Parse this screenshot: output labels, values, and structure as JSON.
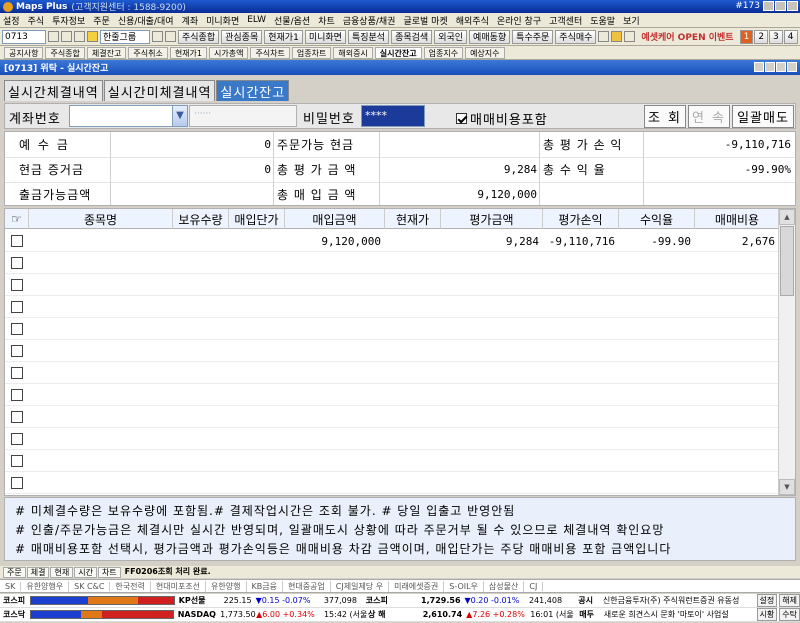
{
  "app": {
    "title": "Maps Plus",
    "subtitle": "(고객지원센터 : 1588-9200)",
    "window_num": "#173"
  },
  "menu": [
    "설정",
    "주식",
    "투자정보",
    "주문",
    "신용/대출/대여",
    "계좌",
    "미니화면",
    "ELW",
    "선물/옵션",
    "차트",
    "금융상품/채권",
    "글로벌 마켓",
    "해외주식",
    "온라인 창구",
    "고객센터",
    "도움말",
    "보기"
  ],
  "toolbar": {
    "screen_no": "0713",
    "group": "한줄그룹",
    "buttons": [
      "주식종합",
      "관심종목",
      "현재가1",
      "미니화면",
      "특징분석",
      "종목검색",
      "외국인",
      "예매동향",
      "특수주문",
      "주식매수"
    ],
    "event": "예셋케어 OPEN 이벤트",
    "pages": [
      "1",
      "2",
      "3",
      "4"
    ]
  },
  "window_tabs": [
    "공지사항",
    "주식종합",
    "체결잔고",
    "주식취소",
    "현재가1",
    "시가총액",
    "주식차트",
    "업종차트",
    "해외증시",
    "실시간잔고",
    "업종지수",
    "예상지수"
  ],
  "window": {
    "title": "[0713] 위탁 - 실시간잔고"
  },
  "subtabs": [
    "실시간체결내역",
    "실시간미체결내역",
    "실시간잔고"
  ],
  "account": {
    "account_label": "계좌번호",
    "account_value": "",
    "account_name": "······",
    "password_label": "비밀번호",
    "password_value": "****",
    "fee_include_label": "매매비용포함",
    "query_button": "조 회",
    "next_button": "연 속",
    "sell_all_button": "일괄매도"
  },
  "summary": {
    "deposit_label": "예 수 금",
    "deposit_value": "0",
    "cash_margin_label": "현금 증거금",
    "cash_margin_value": "0",
    "withdrawable_label": "출금가능금액",
    "withdrawable_value": "",
    "order_cash_label": "주문가능 현금",
    "order_cash_value": "",
    "total_eval_label": "총 평 가 금 액",
    "total_eval_value": "9,284",
    "total_buy_label": "총 매 입 금 액",
    "total_buy_value": "9,120,000",
    "total_pl_label": "총 평 가 손 익",
    "total_pl_value": "-9,110,716",
    "total_return_label": "총 수 익 율",
    "total_return_value": "-99.90%"
  },
  "grid": {
    "columns": [
      "종목명",
      "보유수량",
      "매입단가",
      "매입금액",
      "현재가",
      "평가금액",
      "평가손익",
      "수익율",
      "매매비용"
    ],
    "rows": [
      {
        "name": "",
        "qty": "",
        "avg_price": "",
        "buy_amt": "9,120,000",
        "cur_price": "",
        "eval_amt": "9,284",
        "pl": "-9,110,716",
        "rate": "-99.90",
        "fee": "2,676"
      }
    ],
    "empty_rows": 11
  },
  "notes": [
    "# 미체결수량은 보유수량에 포함됨.# 결제작업시간은 조회 불가. # 당일 입출고 반영안됨",
    "# 인출/주문가능금은 체결시만 실시간 반영되며, 일괄매도시 상황에 따라 주문거부 될 수 있으므로 체결내역 확인요망",
    "# 매매비용포함 선택시, 평가금액과 평가손익등은 매매비용 차감 금액이며, 매입단가는 주당 매매비용 포함 금액입니다"
  ],
  "status": {
    "tabs": [
      "주문",
      "체결",
      "현재",
      "시간",
      "차트"
    ],
    "message": "FF0206조회 처리 완료."
  },
  "stock_strip": [
    "SK",
    "유한양행우",
    "SK C&C",
    "한국전력",
    "현대미포조선",
    "유한양행",
    "KB금융",
    "현대중공업",
    "CJ제일제당 우",
    "미래에셋증권",
    "S-OIL우",
    "삼성물산",
    "CJ"
  ],
  "ticker1": {
    "name": "코스피",
    "bar": [
      0.4,
      0.35,
      0.25
    ],
    "index_name": "KP선물",
    "index_value": "225.15",
    "index_change": "▼0.15 -0.07%",
    "index_qty": "377,098",
    "market_name": "코스피",
    "market_value": "1,729.56",
    "market_change": "▼0.20 -0.01%",
    "market_qty": "241,408",
    "tag": "공시",
    "news": "신한금융투자(주) 주식워런트증권 유동성",
    "btn1": "설정",
    "btn2": "해제"
  },
  "ticker2": {
    "name": "코스닥",
    "bar": [
      0.35,
      0.15,
      0.5
    ],
    "index_name": "NASDAQ",
    "index_value": "1,773.50",
    "index_change": "▲6.00 +0.34%",
    "index_qty": "15:42 (서울",
    "market_name": "상 해",
    "market_value": "2,610.74",
    "market_change": "▲7.26 +0.28%",
    "market_qty": "16:01 (서울",
    "tag": "매두",
    "news": "새로운 희견스시 문화 '마토이' 사업설",
    "btn1": "시황",
    "btn2": "수탁"
  },
  "colors": {
    "accent": "#3a78c8",
    "title_bar": "#1a4fb8",
    "notes_bg": "#e9f0fb",
    "up": "#dd0000",
    "down": "#0000cc"
  }
}
